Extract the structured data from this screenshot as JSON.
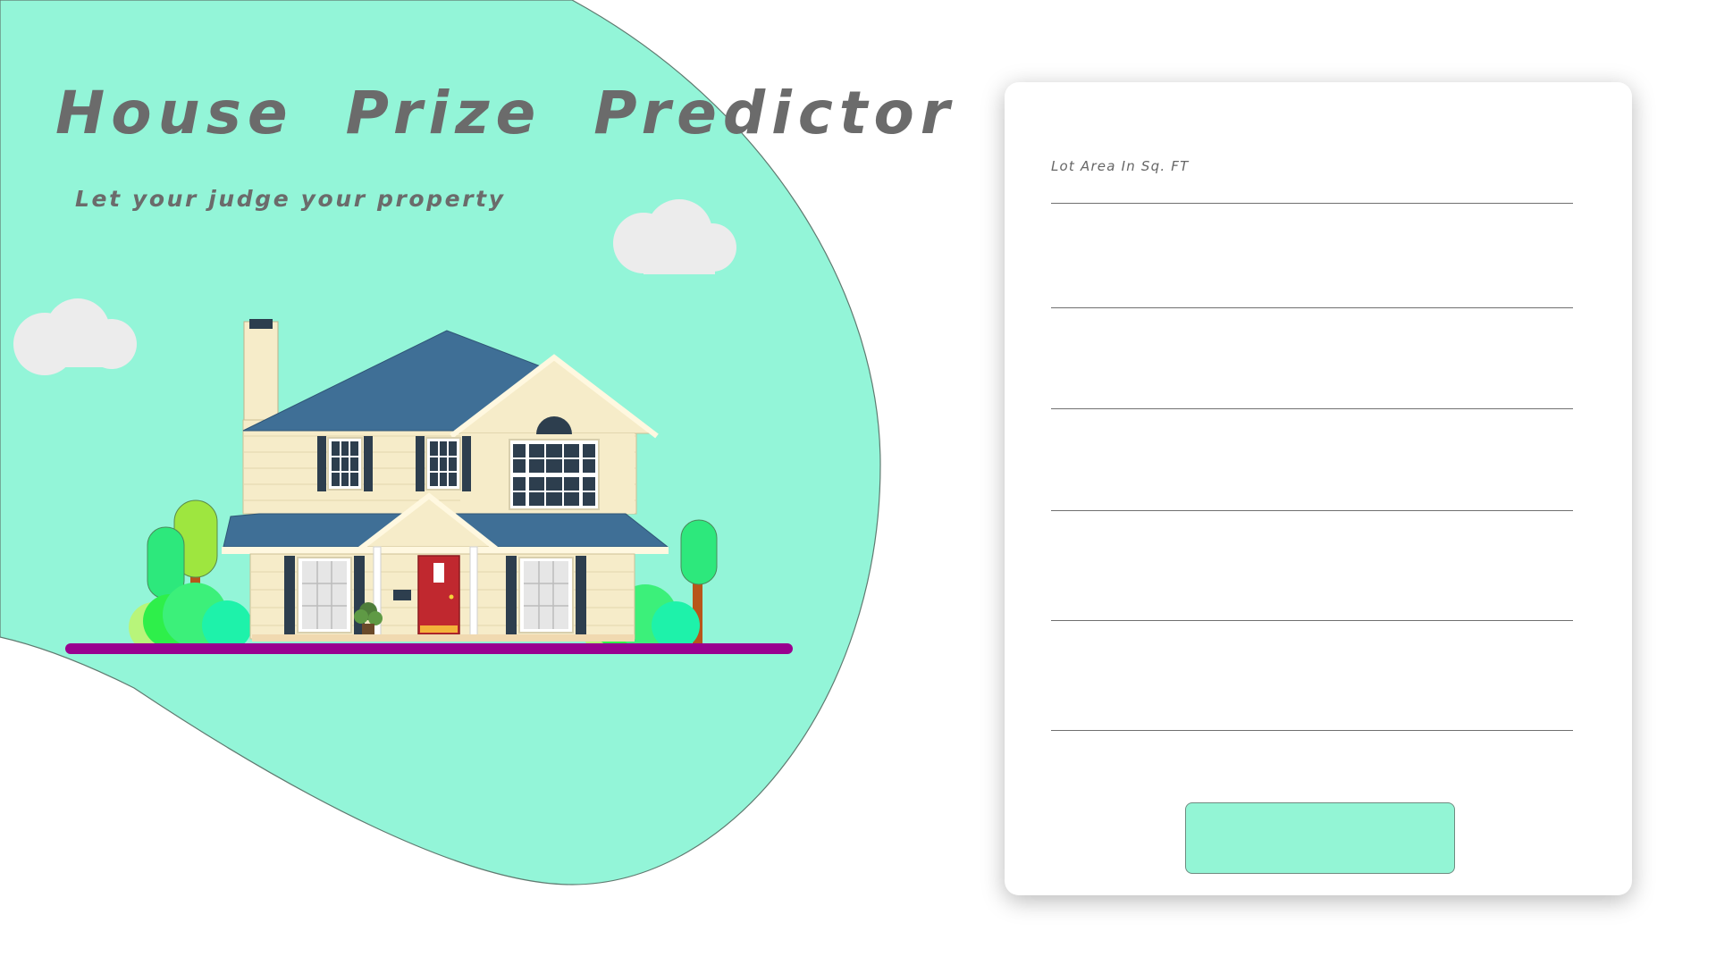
{
  "hero": {
    "title": "House  Prize  Predictor",
    "subtitle": "Let your judge your property"
  },
  "form": {
    "fields": [
      {
        "label": "Lot Area In Sq. FT",
        "value": "",
        "placeholder": ""
      },
      {
        "label": "",
        "value": "",
        "placeholder": ""
      },
      {
        "label": "",
        "value": "",
        "placeholder": ""
      },
      {
        "label": "",
        "value": "",
        "placeholder": ""
      },
      {
        "label": "",
        "value": "",
        "placeholder": ""
      },
      {
        "label": "",
        "value": "",
        "placeholder": ""
      }
    ],
    "submit_label": ""
  },
  "colors": {
    "blob": "#93f5d8",
    "ground": "#99008f",
    "button": "#93f5d5",
    "roof": "#3f6f96",
    "wall": "#f6ecc9",
    "door": "#c0282f"
  },
  "icons": [
    "cloud-icon",
    "house-icon",
    "tree-icon",
    "bush-icon"
  ]
}
